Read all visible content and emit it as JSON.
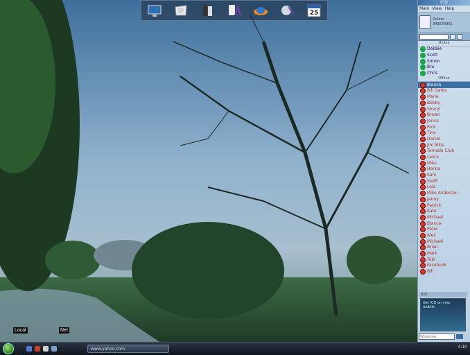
{
  "dock": {
    "icons": [
      "monitor-icon",
      "mail-icon",
      "book-icon",
      "font-icon",
      "jet-icon",
      "gears-icon",
      "calendar-icon"
    ],
    "calendar_day": "25"
  },
  "desktop": {
    "labels": [
      "Local",
      "Net"
    ]
  },
  "taskbar": {
    "task_button": "www.yahoo.com",
    "clock": "4:10"
  },
  "messenger": {
    "title": "ICQ",
    "menu": [
      "Main",
      "View",
      "Help"
    ],
    "status_line_1": "Online",
    "status_line_2": "345678901",
    "groups": {
      "online": "Online",
      "offline": "Offline"
    },
    "online_contacts": [
      "Debbie",
      "Scott",
      "Simon",
      "Bro",
      "Chris"
    ],
    "offline_contacts": [
      "Bianca",
      "Bill Gates",
      "Marie",
      "Bobby",
      "Sheryl",
      "Brown",
      "Jenna",
      "Rick",
      "Tina",
      "Daniel",
      "Jim Mills",
      "Tornado Club",
      "Laura",
      "Mike",
      "Hanna",
      "Sam",
      "Steffi",
      "Lola",
      "Mike Anderson",
      "Jenny",
      "Patrick",
      "Kate",
      "Michael",
      "Bianca",
      "Peter",
      "Alex",
      "Michael",
      "Brian",
      "Mark",
      "Tobi",
      "Facebook",
      "Bill"
    ],
    "ad_header": "ICQ",
    "ad_text": "Get ICQ on your mobile",
    "search_placeholder": "Whatsnew"
  }
}
